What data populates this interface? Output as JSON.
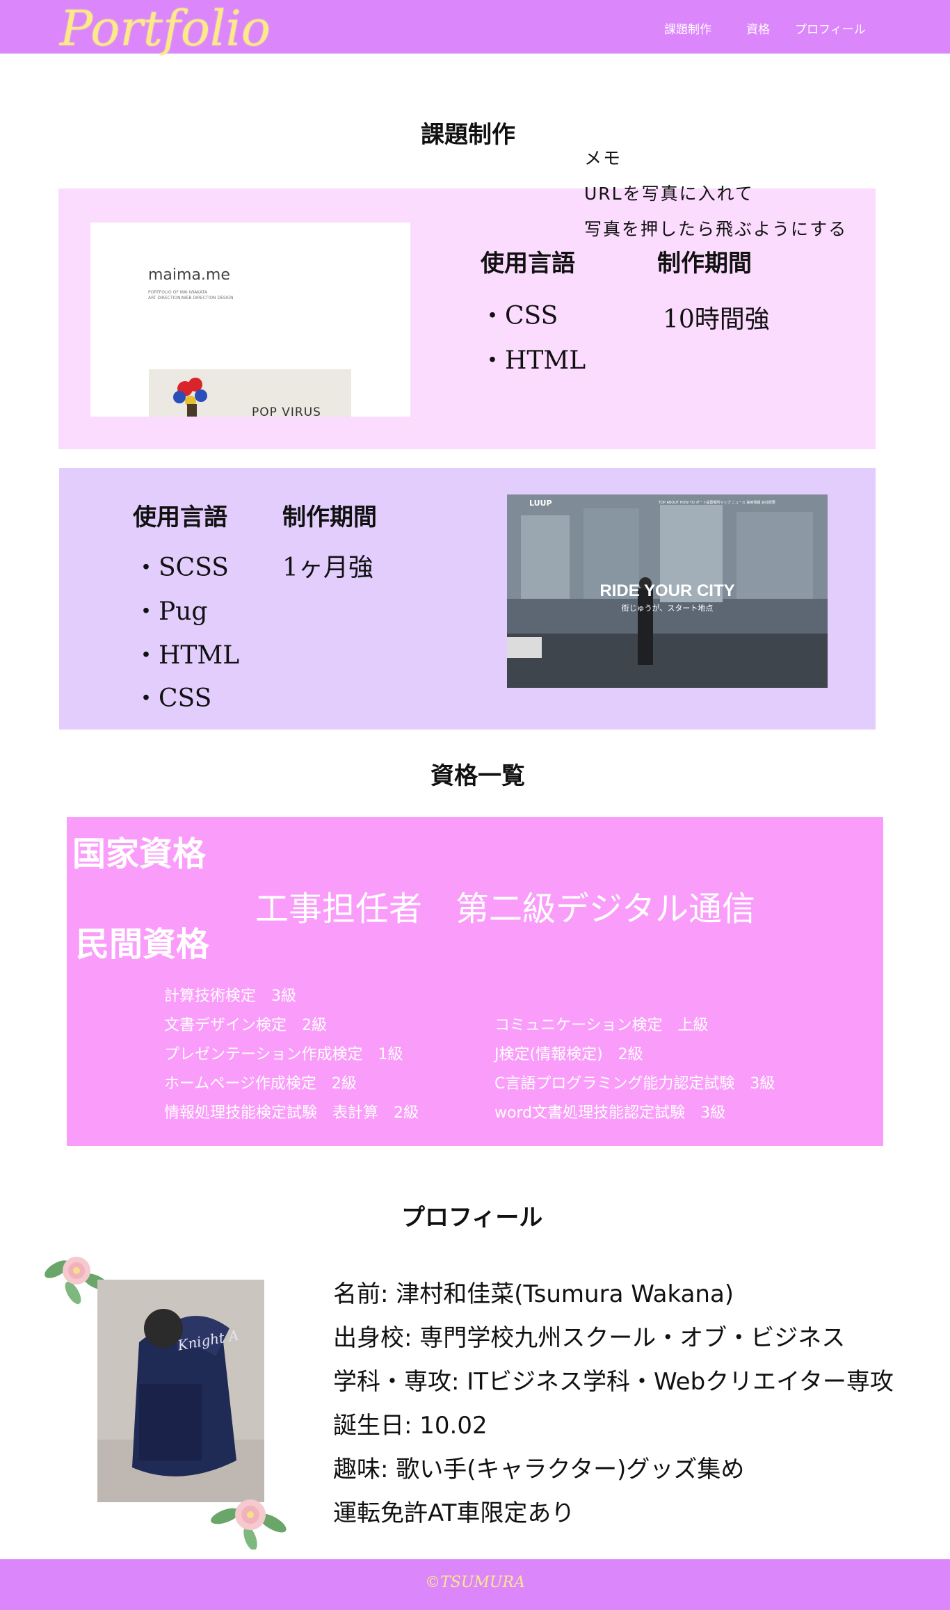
{
  "header": {
    "logo": "Portfolio",
    "nav": [
      "課題制作",
      "資格",
      "プロフィール"
    ]
  },
  "works": {
    "title": "課題制作",
    "memo": [
      "メモ",
      "URLを写真に入れて",
      "写真を押したら飛ぶようにする"
    ],
    "cards": [
      {
        "lang_label": "使用言語",
        "period_label": "制作期間",
        "languages": [
          "・CSS",
          "・HTML"
        ],
        "period": "10時間強",
        "thumb_brand": "maima.me",
        "thumb_sub1": "PORTFOLIO OF MAI IWAKATA",
        "thumb_sub2": "ART DIRECTION/WEB DIRECTION DESIGN",
        "thumb_caption": "POP VIRUS"
      },
      {
        "lang_label": "使用言語",
        "period_label": "制作期間",
        "languages": [
          "・SCSS",
          "・Pug",
          "・HTML",
          "・CSS"
        ],
        "period": "1ヶ月強",
        "thumb_brand": "LUUP",
        "thumb_menu": "TOP ABOUT HOW TO ポート設置場所マップ ニュース 採用情報 会社概要",
        "thumb_headline": "RIDE YOUR CITY",
        "thumb_subline": "街じゅうが、スタート地点"
      }
    ]
  },
  "qualifications": {
    "title": "資格一覧",
    "national_label": "国家資格",
    "national_item": "工事担任者　第二級デジタル通信",
    "private_label": "民間資格",
    "private_left": [
      "計算技術検定　3級",
      "文書デザイン検定　2級",
      "プレゼンテーション作成検定　1級",
      "ホームページ作成検定　2級",
      "情報処理技能検定試験　表計算　2級"
    ],
    "private_right": [
      "コミュニケーション検定　上級",
      "J検定(情報検定)　2級",
      "C言語プログラミング能力認定試験　3級",
      "word文書処理技能認定試験　3級"
    ]
  },
  "profile": {
    "title": "プロフィール",
    "lines": [
      "名前:  津村和佳菜(Tsumura Wakana)",
      "出身校:  専門学校九州スクール・オブ・ビジネス",
      "学科・専攻:  ITビジネス学科・Webクリエイター専攻",
      "誕生日:  10.02",
      "趣味:  歌い手(キャラクター)グッズ集め",
      "運転免許AT車限定あり"
    ],
    "photo_fan_text": "Knight A"
  },
  "footer": {
    "copyright": "©TSUMURA"
  },
  "colors": {
    "header_bg": "#db86fb",
    "logo": "#fbe98a",
    "card1_bg": "#fcdcfe",
    "card2_bg": "#e2cdfd",
    "qual_bg": "#fa9dfa"
  }
}
